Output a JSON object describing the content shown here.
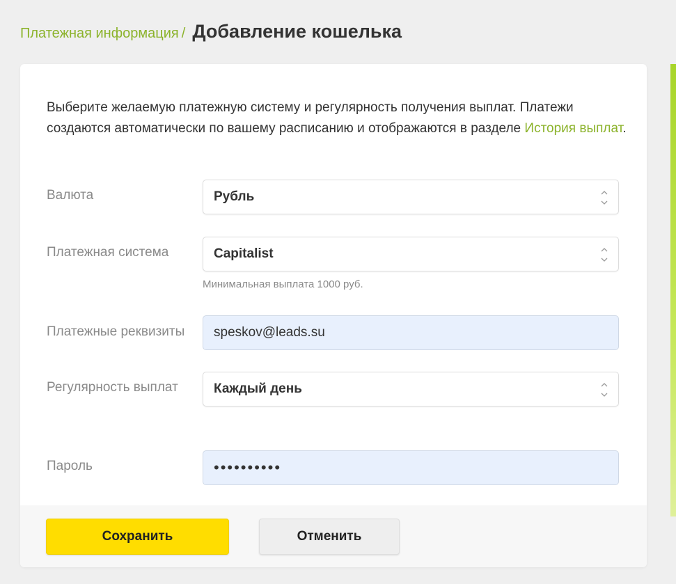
{
  "breadcrumb": {
    "parent": "Платежная информация",
    "separator": "/",
    "current": "Добавление кошелька"
  },
  "intro": {
    "text": "Выберите желаемую платежную систему и регулярность получения выплат. Платежи создаются автоматически по вашему расписанию и отображаются в разделе ",
    "link": "История выплат",
    "suffix": "."
  },
  "form": {
    "currency": {
      "label": "Валюта",
      "value": "Рубль"
    },
    "payment_system": {
      "label": "Платежная система",
      "value": "Capitalist",
      "hint": "Минимальная выплата 1000 руб."
    },
    "details": {
      "label": "Платежные реквизиты",
      "value": "speskov@leads.su"
    },
    "frequency": {
      "label": "Регулярность выплат",
      "value": "Каждый день"
    },
    "password": {
      "label": "Пароль",
      "value": "••••••••••"
    }
  },
  "actions": {
    "save_label": "Сохранить",
    "cancel_label": "Отменить"
  },
  "colors": {
    "accent": "#8cb32c",
    "primary_button": "#ffdd00",
    "autofill_bg": "#e8f0fd"
  },
  "icons": {
    "select_arrows": "chevron-up-down-icon"
  }
}
